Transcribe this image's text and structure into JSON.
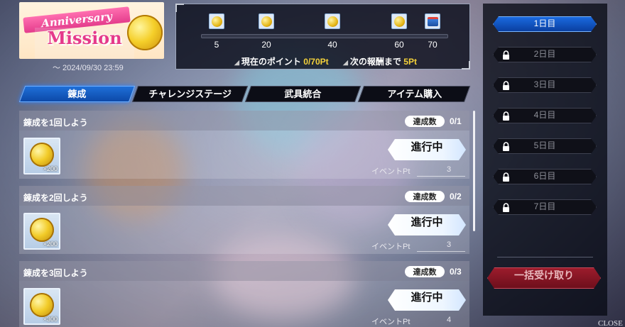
{
  "banner": {
    "ribbon_text": "Anniversary",
    "title": "Mission",
    "period": "～ 2024/09/30 23:59"
  },
  "progress": {
    "milestones": [
      {
        "label": "5",
        "reward": "coin-icon"
      },
      {
        "label": "20",
        "reward": "coin-icon"
      },
      {
        "label": "40",
        "reward": "coin-icon"
      },
      {
        "label": "60",
        "reward": "coin-icon"
      },
      {
        "label": "70",
        "reward": "chest-icon"
      }
    ],
    "current_label": "現在のポイント",
    "current_value": "0/70Pt",
    "next_label": "次の報酬まで",
    "next_value": "5Pt"
  },
  "tabs": [
    {
      "label": "錬成",
      "active": true
    },
    {
      "label": "チャレンジステージ",
      "active": false
    },
    {
      "label": "武具統合",
      "active": false
    },
    {
      "label": "アイテム購入",
      "active": false
    }
  ],
  "missions": [
    {
      "title": "錬成を1回しよう",
      "badge": "達成数",
      "count": "0/1",
      "reward_qty": "×200",
      "status": "進行中",
      "event_label": "イベントPt",
      "event_value": "3"
    },
    {
      "title": "錬成を2回しよう",
      "badge": "達成数",
      "count": "0/2",
      "reward_qty": "×200",
      "status": "進行中",
      "event_label": "イベントPt",
      "event_value": "3"
    },
    {
      "title": "錬成を3回しよう",
      "badge": "達成数",
      "count": "0/3",
      "reward_qty": "×300",
      "status": "進行中",
      "event_label": "イベントPt",
      "event_value": "4"
    }
  ],
  "days": [
    {
      "label": "1日目",
      "locked": false,
      "active": true
    },
    {
      "label": "2日目",
      "locked": true,
      "active": false
    },
    {
      "label": "3日目",
      "locked": true,
      "active": false
    },
    {
      "label": "4日目",
      "locked": true,
      "active": false
    },
    {
      "label": "5日目",
      "locked": true,
      "active": false
    },
    {
      "label": "6日目",
      "locked": true,
      "active": false
    },
    {
      "label": "7日目",
      "locked": true,
      "active": false
    }
  ],
  "claim_all_label": "一括受け取り",
  "close_label": "CLOSE"
}
